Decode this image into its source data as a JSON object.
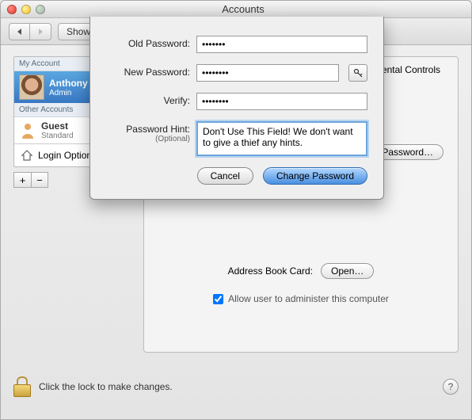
{
  "window": {
    "title": "Accounts"
  },
  "toolbar": {
    "show_all": "Show All"
  },
  "sidebar": {
    "my_account_header": "My Account",
    "other_header": "Other Accounts",
    "me": {
      "name": "Anthony",
      "role": "Admin"
    },
    "guest": {
      "name": "Guest",
      "role": "Standard"
    },
    "login_options": "Login Options"
  },
  "main": {
    "tab_parental": "Parental Controls",
    "password_button": "Password…",
    "address_label": "Address Book Card:",
    "open_button": "Open…",
    "admin_checkbox": "Allow user to administer this computer"
  },
  "lock": {
    "text": "Click the lock to make changes."
  },
  "sheet": {
    "old_label": "Old Password:",
    "new_label": "New Password:",
    "verify_label": "Verify:",
    "hint_label": "Password Hint:",
    "hint_optional": "(Optional)",
    "old_value": "•••••••",
    "new_value": "••••••••",
    "verify_value": "••••••••",
    "hint_value": "Don't Use This Field! We don't want to give a thief any hints.",
    "cancel": "Cancel",
    "change": "Change Password"
  }
}
